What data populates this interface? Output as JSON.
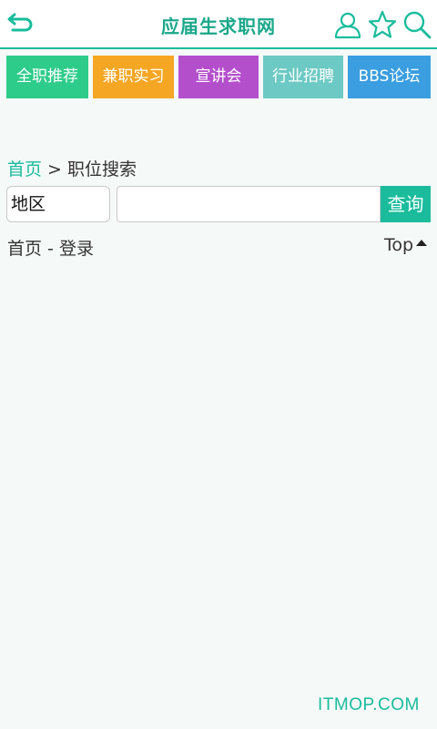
{
  "header": {
    "title": "应届生求职网",
    "back_icon": "back-arrow-icon",
    "icons": [
      "user-icon",
      "star-icon",
      "search-icon"
    ],
    "accent_color": "#1abc9c"
  },
  "nav": [
    {
      "label": "全职推荐",
      "color": "#2ecc8a"
    },
    {
      "label": "兼职实习",
      "color": "#f5a623"
    },
    {
      "label": "宣讲会",
      "color": "#b44fcc"
    },
    {
      "label": "行业招聘",
      "color": "#6cc9c3"
    },
    {
      "label": "BBS论坛",
      "color": "#3a9ee0"
    }
  ],
  "breadcrumb": {
    "home": "首页",
    "separator": " > ",
    "current": "职位搜索"
  },
  "search": {
    "region": "地区",
    "keyword_value": "",
    "keyword_placeholder": "",
    "button_label": "查询"
  },
  "footer": {
    "home": "首页",
    "separator": " - ",
    "login": "登录",
    "top": "Top"
  },
  "watermark": "ITMOP.COM"
}
